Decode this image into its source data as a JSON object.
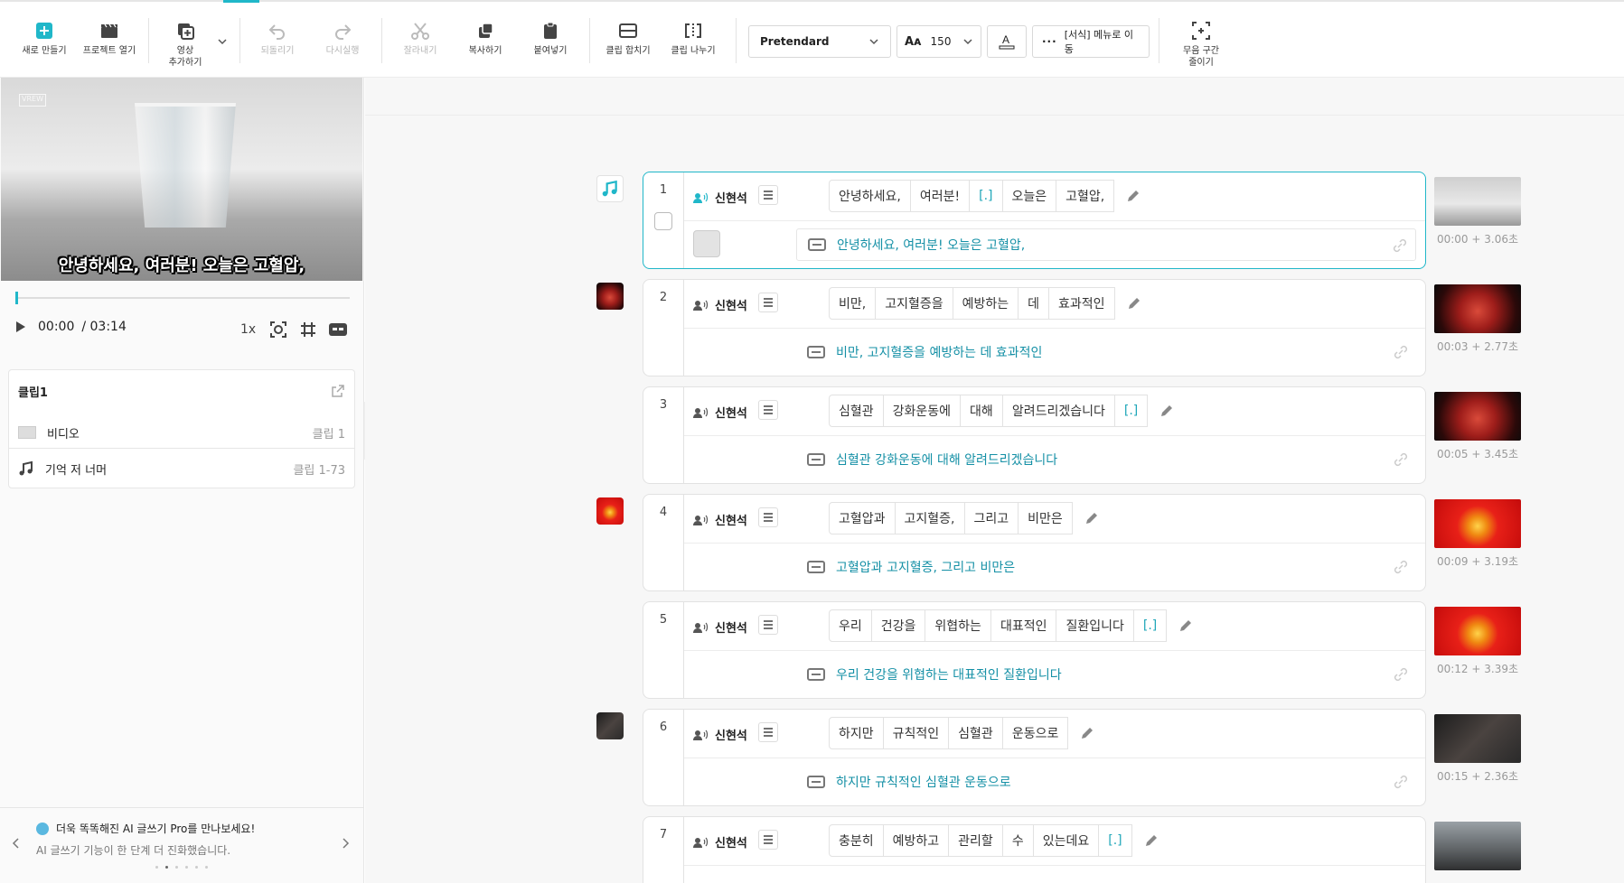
{
  "toolbar": {
    "new": "새로 만들기",
    "open": "프로젝트 열기",
    "add_video_1": "영상",
    "add_video_2": "추가하기",
    "undo": "되돌리기",
    "redo": "다시실행",
    "cut": "잘라내기",
    "copy": "복사하기",
    "paste": "붙여넣기",
    "merge": "클립 합치기",
    "split": "클립 나누기",
    "font": "Pretendard",
    "font_size": "150",
    "format_menu": "[서식] 메뉴로 이동",
    "silence_1": "무음 구간",
    "silence_2": "줄이기"
  },
  "preview": {
    "caption": "안녕하세요, 여러분! 오늘은 고혈압,",
    "current_time": "00:00",
    "total_time": "/ 03:14",
    "speed": "1x",
    "progress_fraction": 0.0
  },
  "clip_card": {
    "title": "클립1",
    "video_label": "비디오",
    "video_range": "클립 1",
    "music_label": "기억 저 너머",
    "music_range": "클립 1-73"
  },
  "promo": {
    "title": "더욱 똑똑해진 AI 글쓰기 Pro를 만나보세요!",
    "subtitle": "AI 글쓰기 기능이 한 단계 더 진화했습니다."
  },
  "segments": [
    {
      "num": "1",
      "speaker": "신현석",
      "words": [
        "안녕하세요,",
        "여러분!",
        "[.]",
        "오늘은",
        "고혈압,"
      ],
      "subtitle": "안녕하세요, 여러분! 오늘은 고혈압,",
      "time": "00:00 + 3.06초"
    },
    {
      "num": "2",
      "speaker": "신현석",
      "words": [
        "비만,",
        "고지혈증을",
        "예방하는",
        "데",
        "효과적인"
      ],
      "subtitle": "비만, 고지혈증을 예방하는 데 효과적인",
      "time": "00:03 + 2.77초"
    },
    {
      "num": "3",
      "speaker": "신현석",
      "words": [
        "심혈관",
        "강화운동에",
        "대해",
        "알려드리겠습니다",
        "[.]"
      ],
      "subtitle": "심혈관 강화운동에 대해 알려드리겠습니다",
      "time": "00:05 + 3.45초"
    },
    {
      "num": "4",
      "speaker": "신현석",
      "words": [
        "고혈압과",
        "고지혈증,",
        "그리고",
        "비만은"
      ],
      "subtitle": "고혈압과 고지혈증, 그리고 비만은",
      "time": "00:09 + 3.19초"
    },
    {
      "num": "5",
      "speaker": "신현석",
      "words": [
        "우리",
        "건강을",
        "위협하는",
        "대표적인",
        "질환입니다",
        "[.]"
      ],
      "subtitle": "우리 건강을 위협하는 대표적인 질환입니다",
      "time": "00:12 + 3.39초"
    },
    {
      "num": "6",
      "speaker": "신현석",
      "words": [
        "하지만",
        "규칙적인",
        "심혈관",
        "운동으로"
      ],
      "subtitle": "하지만 규칙적인 심혈관 운동으로",
      "time": "00:15 + 2.36초"
    },
    {
      "num": "7",
      "speaker": "신현석",
      "words": [
        "충분히",
        "예방하고",
        "관리할",
        "수",
        "있는데요",
        "[.]"
      ],
      "subtitle": "",
      "time": ""
    }
  ],
  "colors": {
    "accent": "#20b7c9",
    "subtitle_text": "#1590a6"
  }
}
